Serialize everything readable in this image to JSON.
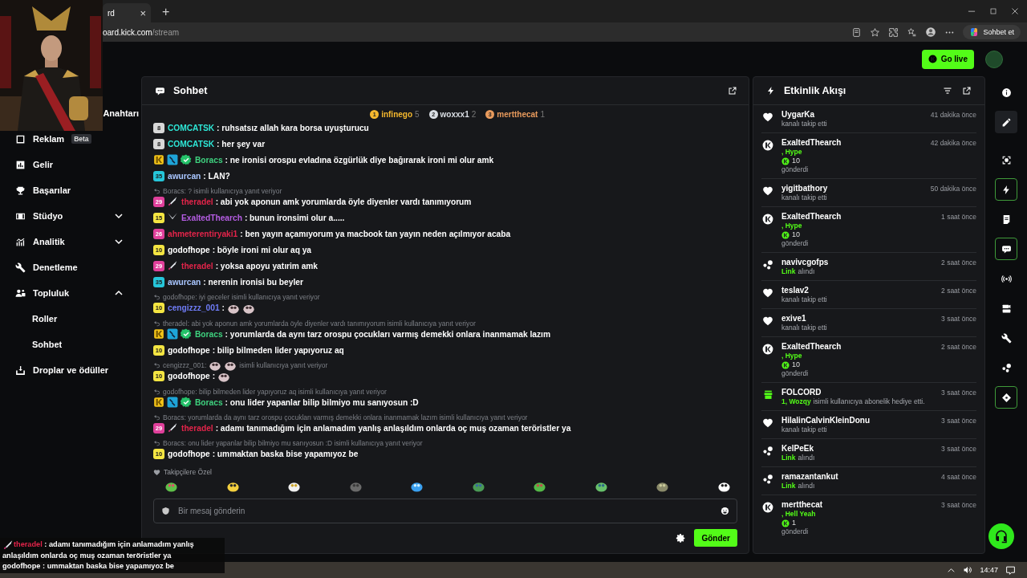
{
  "browser": {
    "tab": {
      "title": "rd",
      "close": "×"
    },
    "new_tab": "+",
    "url": {
      "host": "oard.kick.com",
      "path": "/stream"
    },
    "chat_button": "Sohbet et"
  },
  "header": {
    "go_live": "Go live"
  },
  "sidebar": {
    "items": [
      {
        "label": "Anahtarı"
      },
      {
        "label": "Reklam",
        "kind": "ad",
        "badge": "Beta"
      },
      {
        "label": "Gelir",
        "kind": "revenue"
      },
      {
        "label": "Başarılar",
        "kind": "trophy"
      },
      {
        "label": "Stüdyo",
        "kind": "studio",
        "expanded": false
      },
      {
        "label": "Analitik",
        "kind": "analytics",
        "expanded": false
      },
      {
        "label": "Denetleme",
        "kind": "wrench"
      },
      {
        "label": "Topluluk",
        "kind": "community",
        "expanded": true,
        "children": [
          {
            "label": "Roller"
          },
          {
            "label": "Sohbet"
          }
        ]
      },
      {
        "label": "Droplar ve ödüller",
        "kind": "drops"
      }
    ]
  },
  "chat": {
    "title": "Sohbet",
    "leaders": [
      {
        "rank": "1",
        "user": "infinego",
        "count": "5",
        "color": "#f5b82e"
      },
      {
        "rank": "2",
        "user": "woxxx1",
        "count": "2",
        "color": "#d9dde3"
      },
      {
        "rank": "3",
        "user": "mertthecat",
        "count": "1",
        "color": "#e89a5c"
      }
    ],
    "messages": [
      {
        "badges": [
          {
            "kind": "sub",
            "text": "8",
            "color": "#d8d8d8"
          }
        ],
        "user": "COMCATSK",
        "color": "#2ee6d6",
        "text": ": ruhsatsız allah kara borsa uyuşturucu"
      },
      {
        "badges": [
          {
            "kind": "sub",
            "text": "8",
            "color": "#d8d8d8"
          }
        ],
        "user": "COMCATSK",
        "color": "#2ee6d6",
        "text": ": her şey var"
      },
      {
        "badges": [
          {
            "kind": "og"
          },
          {
            "kind": "mod"
          },
          {
            "kind": "verified"
          }
        ],
        "user": "Boracs",
        "color": "#3fd27f",
        "text": ": ne ironisi orospu evladına özgürlük diye bağırarak ironi mi olur amk"
      },
      {
        "badges": [
          {
            "kind": "sub",
            "text": "35",
            "color": "#26c6da"
          }
        ],
        "user": "awurcan",
        "color": "#a9c6ff",
        "text": ": LAN?"
      },
      {
        "reply": {
          "text": "Boracs: ? isimli kullanıcıya yanıt veriyor"
        },
        "badges": [
          {
            "kind": "sub",
            "text": "29",
            "color": "#e0409b"
          },
          {
            "kind": "sword"
          }
        ],
        "user": "theradel",
        "color": "#e3244a",
        "text": ": abi yok aponun amk yorumlarda öyle diyenler vardı tanımıyorum"
      },
      {
        "badges": [
          {
            "kind": "sub",
            "text": "15",
            "color": "#f4e542"
          },
          {
            "kind": "crossed-swords"
          }
        ],
        "user": "ExaltedThearch",
        "color": "#b55de3",
        "text": ": bunun ironsimi olur a....."
      },
      {
        "badges": [
          {
            "kind": "sub",
            "text": "26",
            "color": "#e0409b"
          }
        ],
        "user": "ahmeterentiryaki1",
        "color": "#e3244a",
        "text": ": ben yayın açamıyorum ya macbook tan yayın neden açılmıyor acaba"
      },
      {
        "badges": [
          {
            "kind": "sub",
            "text": "10",
            "color": "#f4e542"
          }
        ],
        "user": "godofhope",
        "color": "#ffffff",
        "text": ": böyle ironi mi olur aq ya"
      },
      {
        "badges": [
          {
            "kind": "sub",
            "text": "29",
            "color": "#e0409b"
          },
          {
            "kind": "sword"
          }
        ],
        "user": "theradel",
        "color": "#e3244a",
        "text": ": yoksa apoyu yatırim amk"
      },
      {
        "badges": [
          {
            "kind": "sub",
            "text": "35",
            "color": "#26c6da"
          }
        ],
        "user": "awurcan",
        "color": "#a9c6ff",
        "text": ": nerenin ironisi bu beyler"
      },
      {
        "reply": {
          "text": "godofhope: iyi geceler isimli kullanıcıya yanıt veriyor"
        },
        "badges": [
          {
            "kind": "sub",
            "text": "10",
            "color": "#f4e542"
          }
        ],
        "user": "cengizzz_001",
        "color": "#6f7cf6",
        "text": ":",
        "emotes": [
          {
            "kind": "emote"
          },
          {
            "kind": "emote"
          }
        ]
      },
      {
        "reply": {
          "text": "theradel: abi yok aponun amk yorumlarda öyle diyenler vardı tanımıyorum isimli kullanıcıya yanıt veriyor"
        },
        "badges": [
          {
            "kind": "og"
          },
          {
            "kind": "mod"
          },
          {
            "kind": "verified"
          }
        ],
        "user": "Boracs",
        "color": "#3fd27f",
        "text": ": yorumlarda da aynı tarz orospu çocukları varmış demekki onlara inanmamak lazım"
      },
      {
        "badges": [
          {
            "kind": "sub",
            "text": "10",
            "color": "#f4e542"
          }
        ],
        "user": "godofhope",
        "color": "#ffffff",
        "text": ": bilip bilmeden lider yapıyoruz aq"
      },
      {
        "reply": {
          "text": "cengizzz_001:",
          "emotes": [
            {
              "kind": "emote"
            },
            {
              "kind": "emote"
            }
          ],
          "suffix": "isimli kullanıcıya yanıt veriyor"
        },
        "badges": [
          {
            "kind": "sub",
            "text": "10",
            "color": "#f4e542"
          }
        ],
        "user": "godofhope",
        "color": "#ffffff",
        "text": ":",
        "emotes": [
          {
            "kind": "emote"
          }
        ]
      },
      {
        "reply": {
          "text": "godofhope: bilip bilmeden lider yapıyoruz aq isimli kullanıcıya yanıt veriyor"
        },
        "badges": [
          {
            "kind": "og"
          },
          {
            "kind": "mod"
          },
          {
            "kind": "verified"
          }
        ],
        "user": "Boracs",
        "color": "#3fd27f",
        "text": ": onu lider yapanlar bilip bilmiyo mu sanıyosun :D"
      },
      {
        "reply": {
          "text": "Boracs: yorumlarda da aynı tarz orospu çocukları varmış demekki onlara inanmamak lazım isimli kullanıcıya yanıt veriyor"
        },
        "badges": [
          {
            "kind": "sub",
            "text": "29",
            "color": "#e0409b"
          },
          {
            "kind": "sword"
          }
        ],
        "user": "theradel",
        "color": "#e3244a",
        "text": ": adamı tanımadığım için anlamadım yanlış anlaşıldım onlarda oç muş ozaman teröristler ya"
      },
      {
        "reply": {
          "text": "Boracs: onu lider yapanlar bilip bilmiyo mu sanıyosun :D isimli kullanıcıya yanıt veriyor"
        },
        "badges": [
          {
            "kind": "sub",
            "text": "10",
            "color": "#f4e542"
          }
        ],
        "user": "godofhope",
        "color": "#ffffff",
        "text": ": ummaktan baska bise yapamıyoz be"
      }
    ],
    "emote_section": "Takipçilere Özel",
    "input": {
      "placeholder": "Bir mesaj gönderin"
    },
    "send": "Gönder"
  },
  "events": {
    "title": "Etkinlik Akışı",
    "items": [
      {
        "kind": "follow",
        "user": "UygarKa",
        "time": "41 dakika önce",
        "note": "kanalı takip etti"
      },
      {
        "kind": "kicks",
        "user": "ExaltedThearch",
        "time": "42 dakika önce",
        "tier": ", Hype",
        "amount": "10",
        "note": "gönderdi"
      },
      {
        "kind": "follow",
        "user": "yigitbathory",
        "time": "50 dakika önce",
        "note": "kanalı takip etti"
      },
      {
        "kind": "kicks",
        "user": "ExaltedThearch",
        "time": "1 saat önce",
        "tier": ", Hype",
        "amount": "10",
        "note": "gönderdi"
      },
      {
        "kind": "link",
        "user": "navivcgofps",
        "time": "2 saat önce",
        "highlight": "Link",
        "note": "alındı"
      },
      {
        "kind": "follow",
        "user": "teslav2",
        "time": "2 saat önce",
        "note": "kanalı takip etti"
      },
      {
        "kind": "follow",
        "user": "exive1",
        "time": "3 saat önce",
        "note": "kanalı takip etti"
      },
      {
        "kind": "kicks",
        "user": "ExaltedThearch",
        "time": "2 saat önce",
        "tier": ", Hype",
        "amount": "10",
        "note": "gönderdi"
      },
      {
        "kind": "gift",
        "user": "FOLCORD",
        "time": "3 saat önce",
        "highlight": "1, Wozqy",
        "note": "isimli kullanıcıya abonelik hediye etti."
      },
      {
        "kind": "follow",
        "user": "HilalinCalvinKleinDonu",
        "time": "3 saat önce",
        "note": "kanalı takip etti"
      },
      {
        "kind": "link",
        "user": "KelPeEk",
        "time": "3 saat önce",
        "highlight": "Link",
        "note": "alındı"
      },
      {
        "kind": "link",
        "user": "ramazantankut",
        "time": "4 saat önce",
        "highlight": "Link",
        "note": "alındı"
      },
      {
        "kind": "kicks",
        "user": "mertthecat",
        "time": "3 saat önce",
        "tier": ", Hell Yeah",
        "amount": "1",
        "note": "gönderdi"
      }
    ]
  },
  "rail": [
    {
      "kind": "info",
      "active": false,
      "highlighted": false
    },
    {
      "kind": "pencil",
      "active": false,
      "highlighted": true
    },
    {
      "kind": "frame",
      "active": false,
      "highlighted": false
    },
    {
      "kind": "bolt",
      "active": true,
      "highlighted": false
    },
    {
      "kind": "document",
      "active": false,
      "highlighted": false
    },
    {
      "kind": "chat",
      "active": true,
      "highlighted": false
    },
    {
      "kind": "broadcast",
      "active": false,
      "highlighted": false
    },
    {
      "kind": "camera",
      "active": false,
      "highlighted": false
    },
    {
      "kind": "wrench",
      "active": false,
      "highlighted": false
    },
    {
      "kind": "dots",
      "active": false,
      "highlighted": false
    },
    {
      "kind": "ticket",
      "active": true,
      "highlighted": false
    }
  ],
  "stream_overlay": [
    {
      "badges": [
        {
          "kind": "sword"
        }
      ],
      "user": "theradel",
      "color": "#e3244a",
      "text": ": adamı tanımadığım için anlamadım yanlış anlaşıldım onlarda oç muş ozaman teröristler ya"
    },
    {
      "user": "godofhope",
      "color": "#ffffff",
      "text": ": ummaktan baska bise yapamıyoz be"
    }
  ],
  "taskbar": {
    "time": "14:47"
  }
}
